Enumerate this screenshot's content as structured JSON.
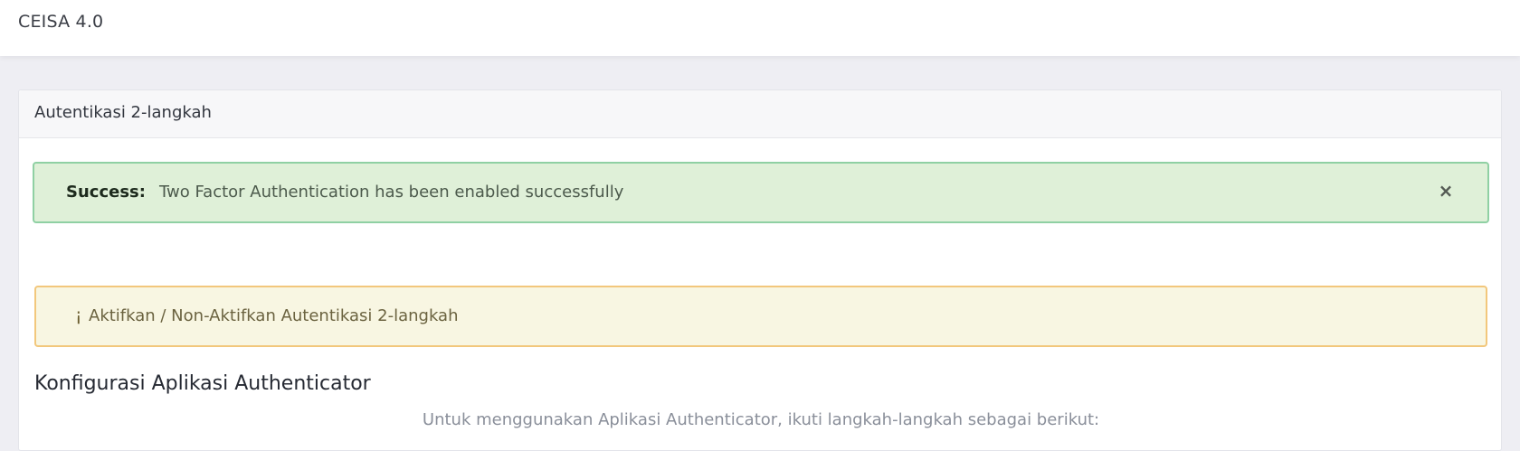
{
  "app": {
    "title": "CEISA 4.0"
  },
  "card": {
    "title": "Autentikasi 2-langkah"
  },
  "success_alert": {
    "label": "Success:",
    "message": "Two Factor Authentication has been enabled successfully",
    "close_glyph": "×",
    "colors": {
      "background": "#dff0d8",
      "border": "#8fd0a3"
    }
  },
  "info_alert": {
    "icon": "info-icon",
    "icon_glyph": "¡",
    "text": "Aktifkan / Non-Aktifkan Autentikasi 2-langkah",
    "colors": {
      "background": "#f8f6e2",
      "border": "#f2c77c"
    }
  },
  "section": {
    "title": "Konfigurasi Aplikasi Authenticator",
    "instructions": "Untuk menggunakan Aplikasi Authenticator, ikuti langkah-langkah sebagai berikut:"
  }
}
